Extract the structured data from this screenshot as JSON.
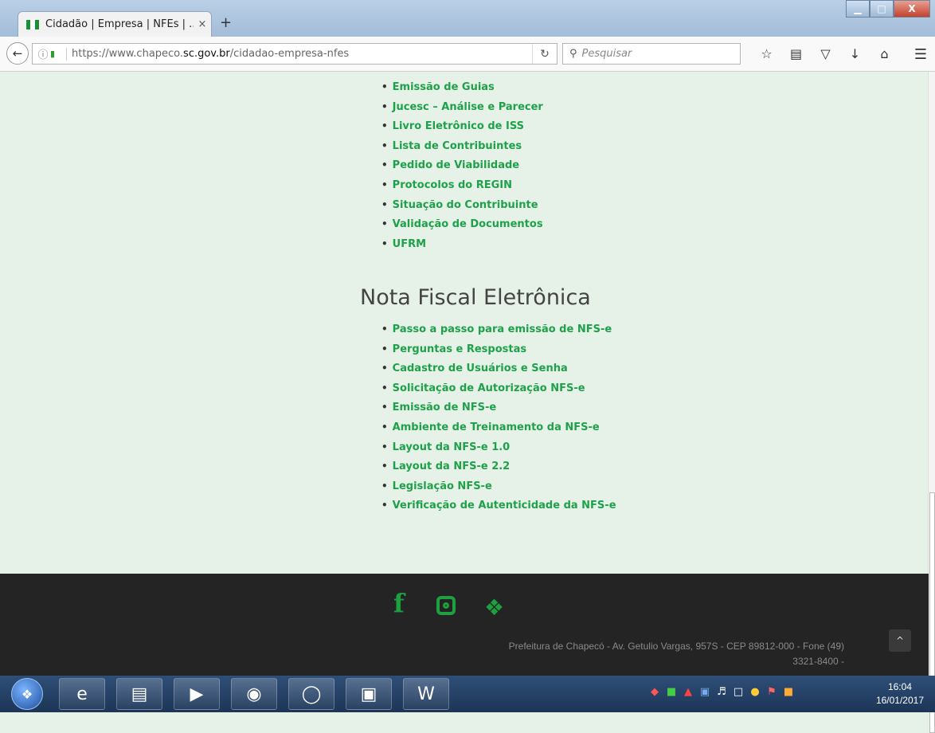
{
  "browser": {
    "tab_title": "Cidadão | Empresa | NFEs | ...",
    "tab_close": "×",
    "new_tab": "+",
    "url_prefix": "https://www.chapeco.",
    "url_domain": "sc.gov.br",
    "url_path": "/cidadao-empresa-nfes",
    "search_placeholder": "Pesquisar",
    "window_controls": {
      "minimize": "▁",
      "maximize": "□",
      "close": "X"
    }
  },
  "page": {
    "list_top": [
      "Emissão de Guias",
      "Jucesc – Análise e Parecer",
      "Livro Eletrônico de ISS",
      "Lista de Contribuintes",
      "Pedido de Viabilidade",
      "Protocolos do REGIN",
      "Situação do Contribuinte",
      "Validação de Documentos",
      "UFRM"
    ],
    "section_title": "Nota Fiscal Eletrônica",
    "list_nfe": [
      "Passo a passo para emissão de NFS-e",
      "Perguntas e Respostas",
      "Cadastro de Usuários e Senha",
      "Solicitação de Autorização NFS-e",
      "Emissão de NFS-e",
      "Ambiente de Treinamento da NFS-e",
      "Layout da NFS-e 1.0",
      "Layout da NFS-e 2.2",
      "Legislação NFS-e",
      "Verificação de Autenticidade da NFS-e"
    ]
  },
  "footer": {
    "address_line1": "Prefeitura de Chapecó - Av. Getulio Vargas, 957S - CEP 89812-000 - Fone (49)",
    "address_line2": "3321-8400 -",
    "back_to_top": "^"
  },
  "taskbar": {
    "time": "16:04",
    "date": "16/01/2017"
  },
  "colors": {
    "link": "#1fa14a",
    "page_bg": "#e6f2e8",
    "footer_bg": "#242424",
    "social": "#1da03f"
  }
}
